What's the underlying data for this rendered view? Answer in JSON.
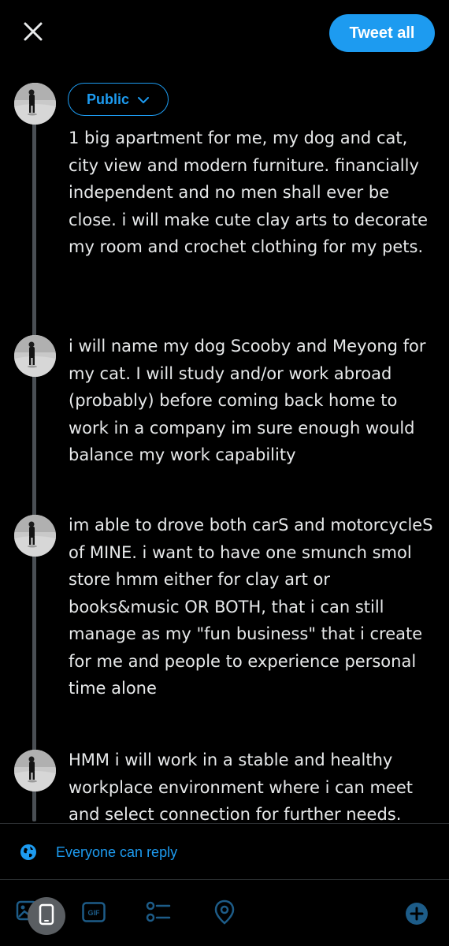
{
  "header": {
    "close_icon": "close-icon",
    "tweet_all_label": "Tweet all"
  },
  "audience": {
    "label": "Public",
    "icon": "chevron-down-icon"
  },
  "thread": [
    {
      "text": "1 big apartment for me, my dog and cat, city view and modern furniture. financially independent and no men shall ever be close. i will make cute clay arts to decorate my room and crochet clothing for my pets."
    },
    {
      "text": "i will name my dog Scooby and Meyong for my cat. I will study and/or work abroad (probably) before coming back home to work in a company im sure enough would balance my work capability"
    },
    {
      "text": "im able to drove both carS and motorcycleS of MINE. i want to have one smunch smol store hmm either for clay art or books&music OR BOTH, that i can still manage as my \"fun business\" that i create for me and people to experience personal time alone"
    },
    {
      "text": "HMM i will work in a stable and healthy workplace environment where i can meet and select connection for further needs."
    }
  ],
  "reply_settings": {
    "icon": "globe-icon",
    "label": "Everyone can reply"
  },
  "toolbar": {
    "items": [
      "image-icon",
      "gif-icon",
      "poll-icon",
      "location-icon",
      "add-icon"
    ],
    "gif_label": "GIF"
  },
  "colors": {
    "accent": "#1d9bf0",
    "background": "#000000",
    "text": "#e7e9ea",
    "thread_line": "#4a4f54",
    "toolbar_icon": "#1d5c88"
  }
}
